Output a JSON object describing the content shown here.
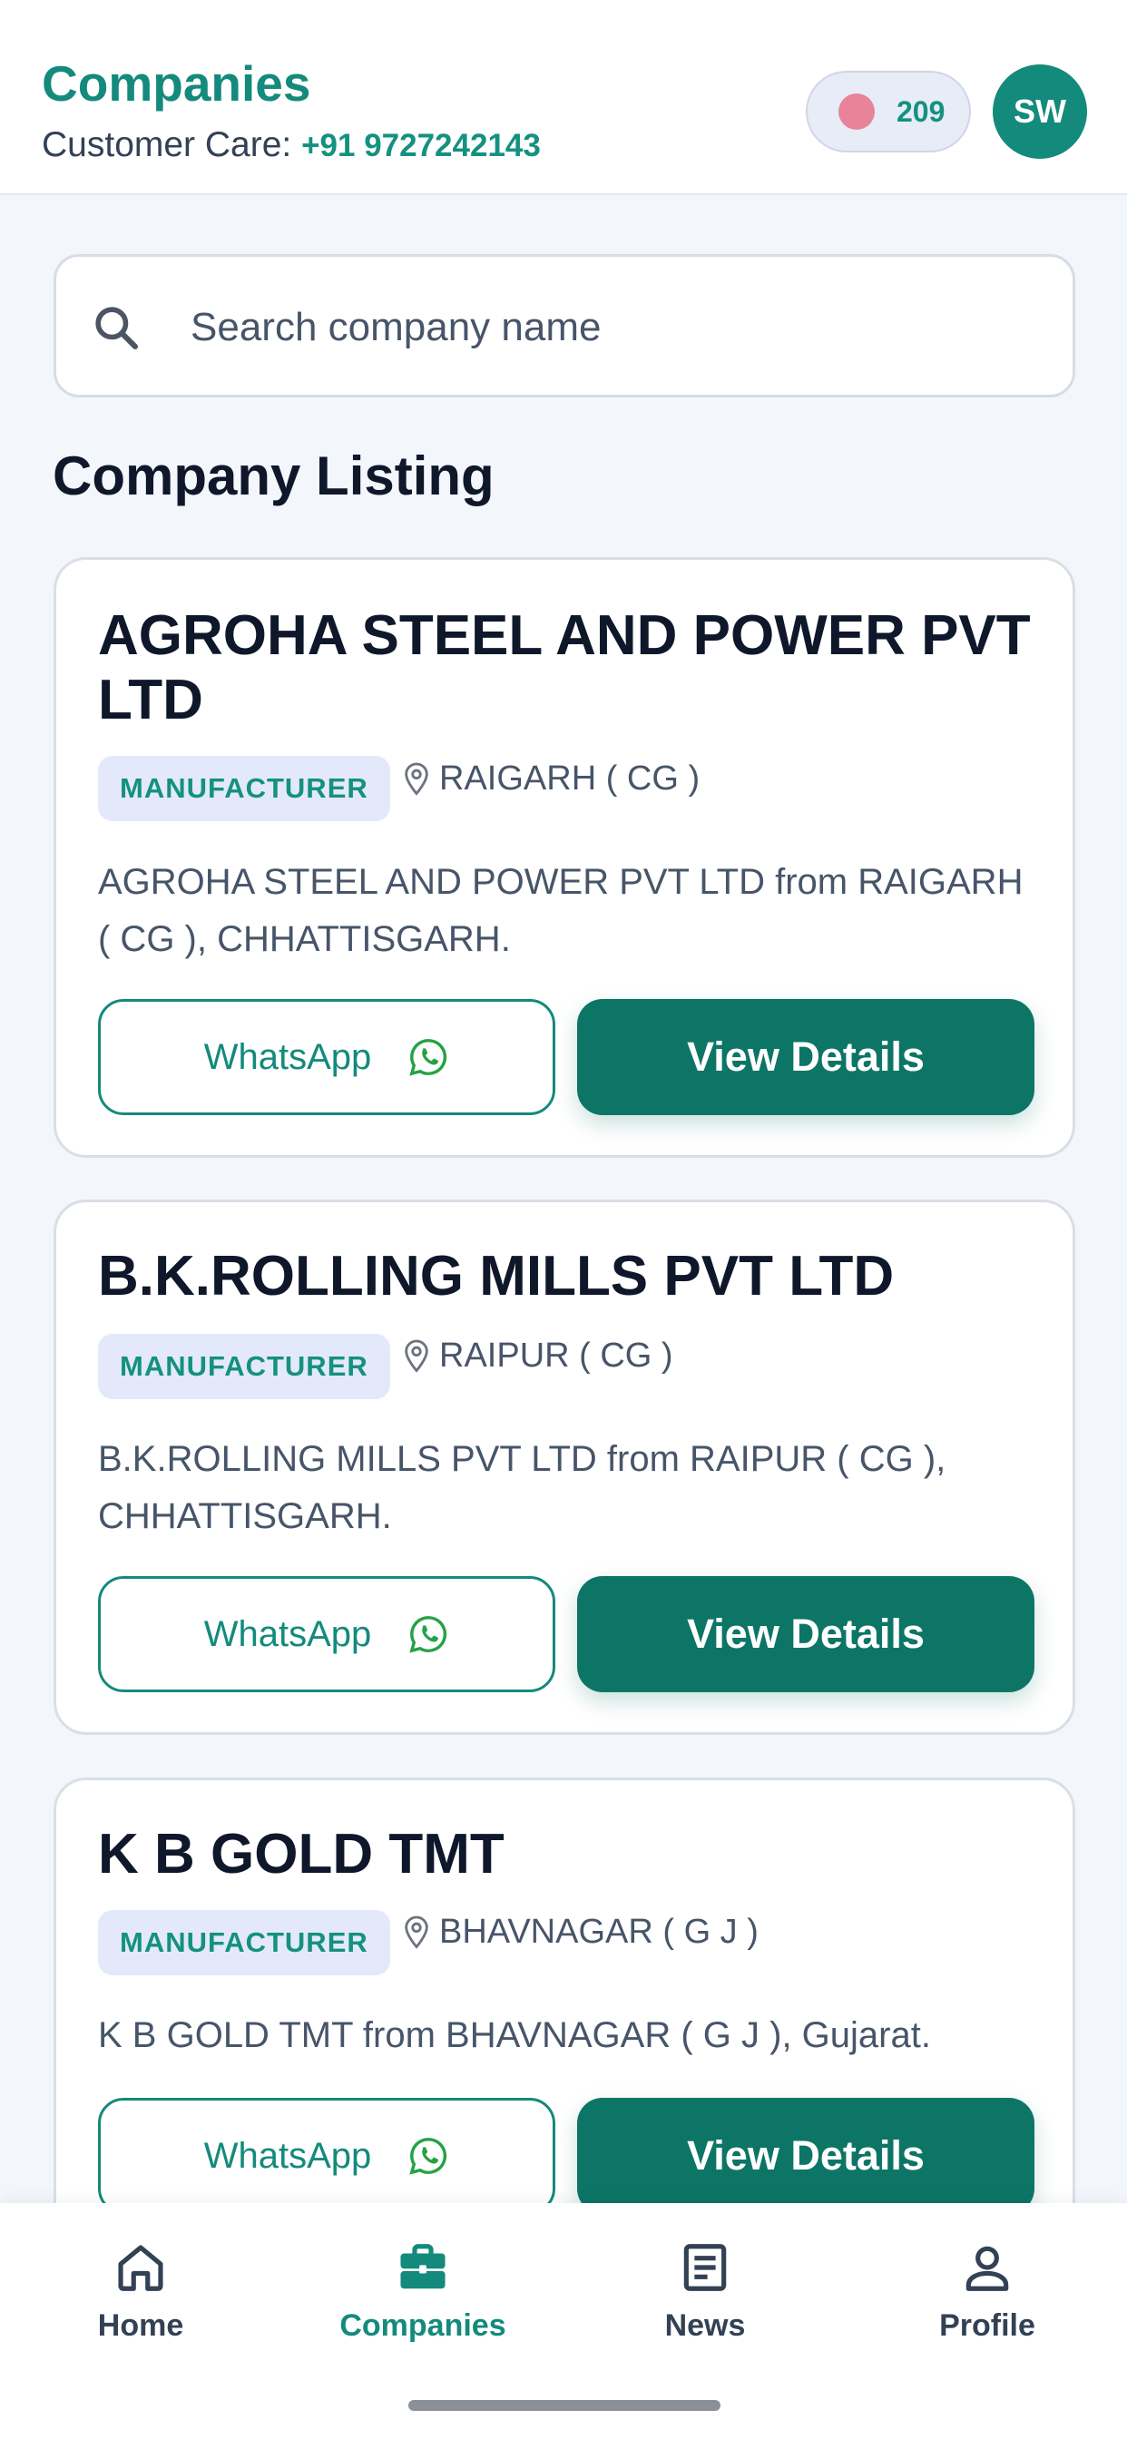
{
  "header": {
    "title": "Companies",
    "customer_care_label": "Customer Care: ",
    "customer_care_phone": "+91 9727242143",
    "coins": "209",
    "avatar_initials": "SW"
  },
  "search": {
    "placeholder": "Search company name",
    "value": ""
  },
  "section_title": "Company Listing",
  "companies": [
    {
      "name": "AGROHA STEEL AND POWER PVT LTD",
      "badge": "MANUFACTURER",
      "location": "RAIGARH ( CG )",
      "description": "AGROHA STEEL AND POWER PVT LTD from RAIGARH ( CG ), CHHATTISGARH.",
      "whatsapp_label": "WhatsApp",
      "view_label": "View Details"
    },
    {
      "name": "B.K.ROLLING MILLS PVT LTD",
      "badge": "MANUFACTURER",
      "location": "RAIPUR ( CG )",
      "description": "B.K.ROLLING MILLS PVT LTD from RAIPUR ( CG ), CHHATTISGARH.",
      "whatsapp_label": "WhatsApp",
      "view_label": "View Details"
    },
    {
      "name": "K B GOLD TMT",
      "badge": "MANUFACTURER",
      "location": "BHAVNAGAR ( G J )",
      "description": "K B GOLD TMT from BHAVNAGAR ( G J ), Gujarat.",
      "whatsapp_label": "WhatsApp",
      "view_label": "View Details"
    }
  ],
  "bottom_nav": {
    "items": [
      {
        "label": "Home",
        "icon": "home-icon",
        "active": false
      },
      {
        "label": "Companies",
        "icon": "briefcase-icon",
        "active": true
      },
      {
        "label": "News",
        "icon": "news-icon",
        "active": false
      },
      {
        "label": "Profile",
        "icon": "person-icon",
        "active": false
      }
    ]
  },
  "colors": {
    "brand": "#138a7c",
    "primary_button": "#0d7566",
    "badge_bg": "#e3e9fa",
    "coin_dot": "#e8839a",
    "whatsapp_icon": "#25a244"
  }
}
